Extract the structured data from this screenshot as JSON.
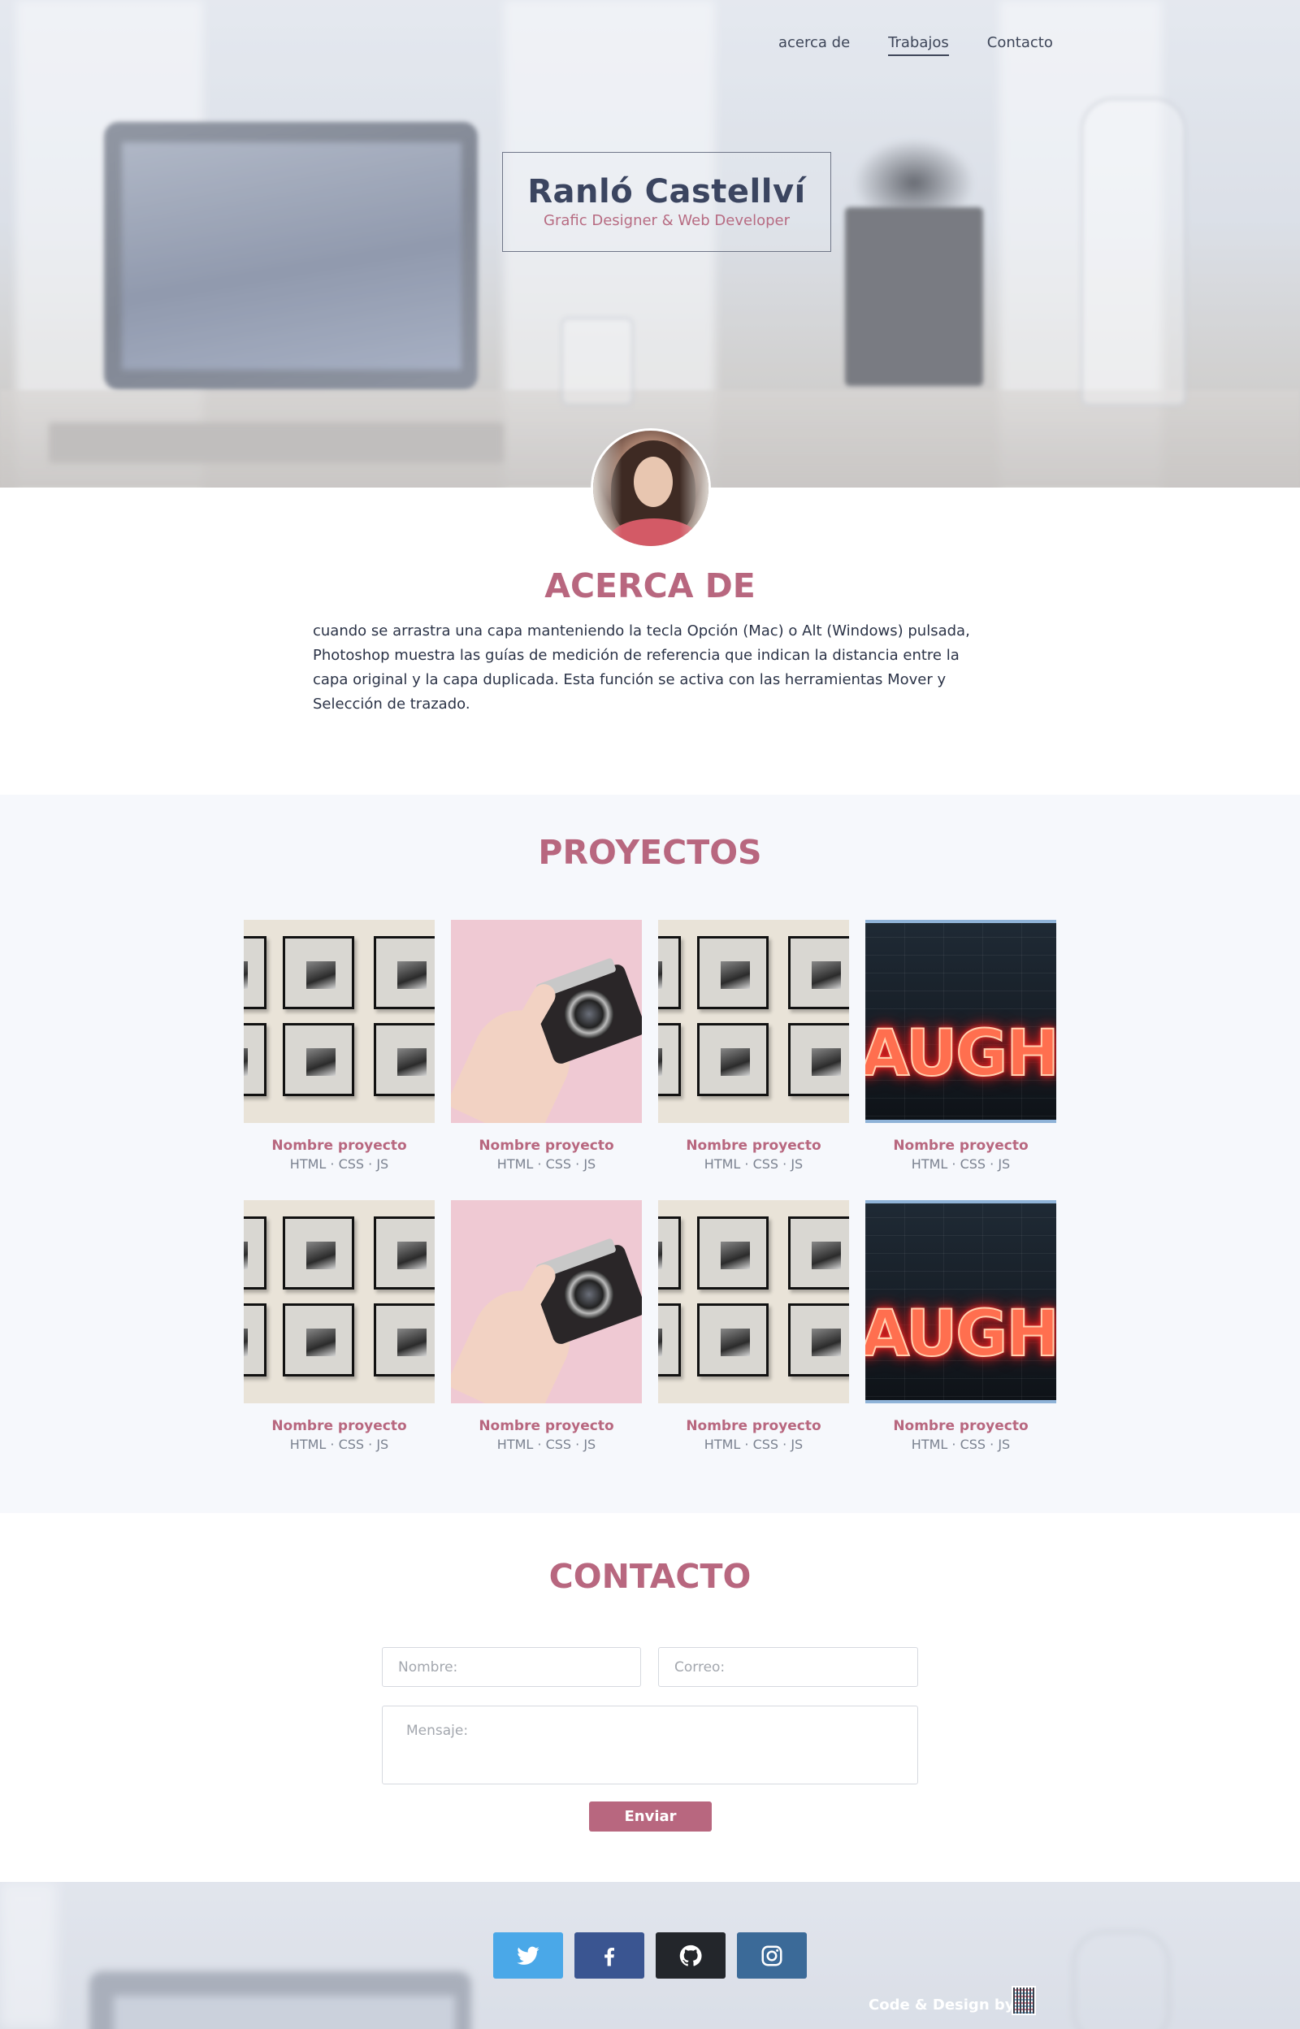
{
  "nav": {
    "items": [
      {
        "label": "acerca de"
      },
      {
        "label": "Trabajos"
      },
      {
        "label": "Contacto"
      }
    ]
  },
  "hero": {
    "name": "Ranló Castellví",
    "tagline": "Grafic Designer &  Web Developer"
  },
  "about": {
    "title": "ACERCA DE",
    "text": "cuando se arrastra una capa manteniendo la tecla Opción (Mac) o Alt (Windows) pulsada, Photoshop muestra las guías de medición de referencia que indican la distancia entre la capa original y la capa duplicada. Esta función se activa con las herramientas Mover y Selección de trazado."
  },
  "projects": {
    "title": "PROYECTOS",
    "items": [
      {
        "name": "Nombre proyecto",
        "tech": "HTML · CSS · JS",
        "image": "frames"
      },
      {
        "name": "Nombre proyecto",
        "tech": "HTML · CSS · JS",
        "image": "camera"
      },
      {
        "name": "Nombre proyecto",
        "tech": "HTML · CSS · JS",
        "image": "frames"
      },
      {
        "name": "Nombre proyecto",
        "tech": "HTML · CSS · JS",
        "image": "laugh-neon"
      },
      {
        "name": "Nombre proyecto",
        "tech": "HTML · CSS · JS",
        "image": "frames"
      },
      {
        "name": "Nombre proyecto",
        "tech": "HTML · CSS · JS",
        "image": "camera"
      },
      {
        "name": "Nombre proyecto",
        "tech": "HTML · CSS · JS",
        "image": "frames"
      },
      {
        "name": "Nombre proyecto",
        "tech": "HTML · CSS · JS",
        "image": "laugh-neon"
      }
    ],
    "neon_text": "AUGH"
  },
  "contact": {
    "title": "CONTACTO",
    "name_placeholder": "Nombre:",
    "email_placeholder": "Correo:",
    "message_placeholder": "Mensaje:",
    "submit_label": "Enviar"
  },
  "footer": {
    "social": [
      {
        "icon": "twitter-icon",
        "color": "#4aa8e8"
      },
      {
        "icon": "facebook-icon",
        "color": "#3a5591"
      },
      {
        "icon": "github-icon",
        "color": "#23262b"
      },
      {
        "icon": "instagram-icon",
        "color": "#3b6a98"
      }
    ],
    "credit": "Code & Design by"
  },
  "colors": {
    "accent": "#b8677f",
    "text_dark": "#2b3347",
    "section_bg": "#f6f8fc"
  }
}
